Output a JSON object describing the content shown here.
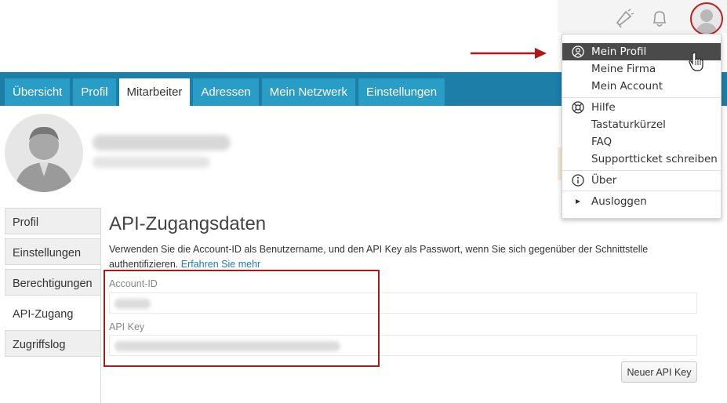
{
  "tabs": [
    {
      "label": "Übersicht",
      "active": false
    },
    {
      "label": "Profil",
      "active": false
    },
    {
      "label": "Mitarbeiter",
      "active": true
    },
    {
      "label": "Adressen",
      "active": false
    },
    {
      "label": "Mein Netzwerk",
      "active": false
    },
    {
      "label": "Einstellungen",
      "active": false
    }
  ],
  "sidebar": {
    "items": [
      {
        "label": "Profil",
        "active": false
      },
      {
        "label": "Einstellungen",
        "active": false
      },
      {
        "label": "Berechtigungen",
        "active": false
      },
      {
        "label": "API-Zugang",
        "active": true
      },
      {
        "label": "Zugriffslog",
        "active": false
      }
    ]
  },
  "content": {
    "heading": "API-Zugangsdaten",
    "description": "Verwenden Sie die Account-ID als Benutzername, und den API Key als Passwort, wenn Sie sich gegenüber der Schnittstelle authentifizieren.",
    "learn_more": "Erfahren Sie mehr",
    "account_id_label": "Account-ID",
    "api_key_label": "API Key",
    "new_key_button": "Neuer API Key"
  },
  "dropdown": {
    "items": [
      {
        "label": "Mein Profil",
        "icon": "profile-icon",
        "active": true
      },
      {
        "label": "Meine Firma",
        "icon": "",
        "active": false
      },
      {
        "label": "Mein Account",
        "icon": "",
        "active": false
      },
      {
        "label": "Hilfe",
        "icon": "lifebuoy-icon",
        "active": false
      },
      {
        "label": "Tastaturkürzel",
        "icon": "",
        "active": false
      },
      {
        "label": "FAQ",
        "icon": "",
        "active": false
      },
      {
        "label": "Supportticket schreiben",
        "icon": "",
        "active": false
      },
      {
        "label": "Über",
        "icon": "info-icon",
        "active": false
      },
      {
        "label": "Ausloggen",
        "icon": "triangle-right-icon",
        "active": false
      }
    ]
  },
  "icons": {
    "announcement": "megaphone-icon",
    "notifications": "bell-icon",
    "user": "avatar"
  },
  "colors": {
    "tabbar": "#1d7ea8",
    "tab": "#2a9dc7",
    "highlight": "#a51c1c",
    "link": "#1d7ea8"
  }
}
